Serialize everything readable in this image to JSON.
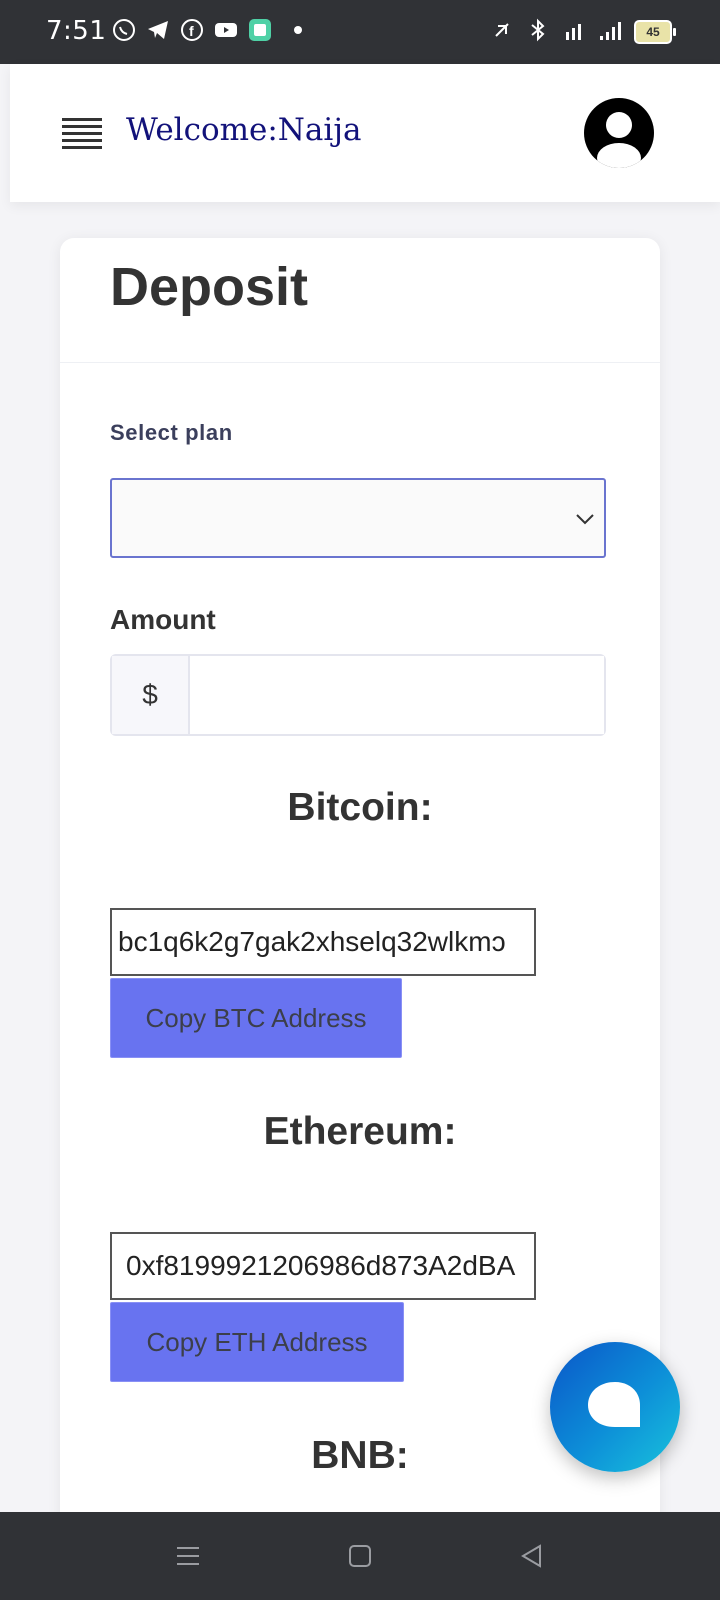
{
  "status_bar": {
    "time": "7:51",
    "left_icons": [
      "whatsapp-icon",
      "telegram-icon",
      "facebook-icon",
      "youtube-icon",
      "app-icon",
      "dot-icon"
    ],
    "right_icons": [
      "vibrate-mute-icon",
      "bluetooth-icon",
      "hplus-signal-icon",
      "signal-icon"
    ],
    "battery": "45"
  },
  "header": {
    "welcome": "Welcome:Naija"
  },
  "card": {
    "title": "Deposit",
    "select_plan_label": "Select plan",
    "select_value": "",
    "amount_label": "Amount",
    "currency_prefix": "$",
    "amount_value": ""
  },
  "coins": {
    "btc": {
      "title": "Bitcoin:",
      "address": "bc1q6k2g7gak2xhselq32wlkmɔ",
      "button": "Copy BTC Address"
    },
    "eth": {
      "title": "Ethereum:",
      "address": "0xf8199921206986d873A2dBA",
      "button": "Copy ETH Address"
    },
    "bnb": {
      "title": "BNB:"
    }
  },
  "chat": {
    "icon": "chat-bubble-icon"
  },
  "navbar": {
    "icons": [
      "menu-icon",
      "home-square-icon",
      "back-triangle-icon"
    ]
  }
}
